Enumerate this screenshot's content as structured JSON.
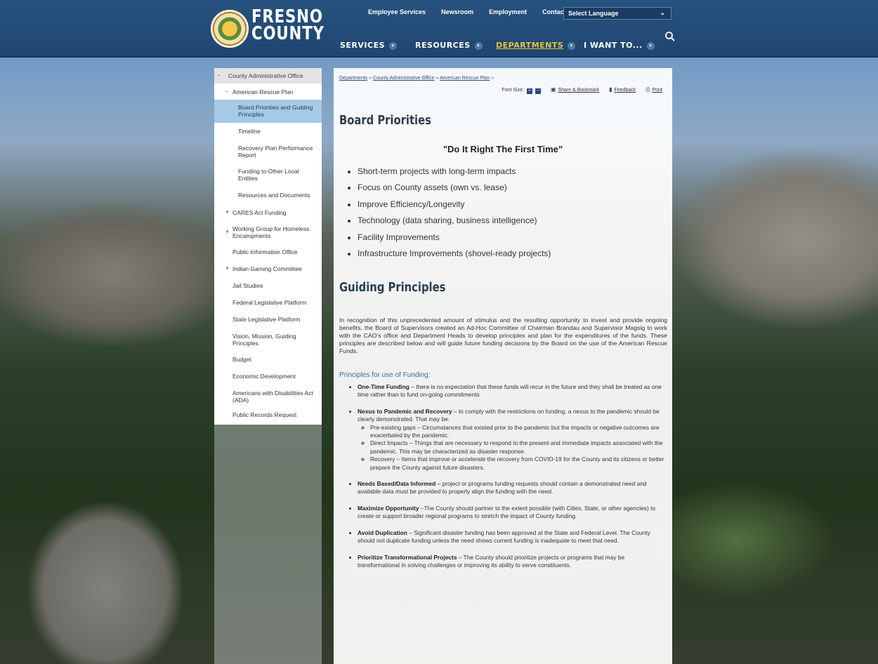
{
  "header": {
    "logo": {
      "seal_text": "THE COUNTY OF FRESNO",
      "line1": "FRESNO",
      "line2": "COUNTY"
    },
    "utility_nav": [
      "Employee Services",
      "Newsroom",
      "Employment",
      "Contact Us"
    ],
    "language_select": "Select Language",
    "main_nav": [
      {
        "label": "SERVICES"
      },
      {
        "label": "RESOURCES"
      },
      {
        "label": "DEPARTMENTS",
        "active": true
      },
      {
        "label": "I WANT TO..."
      }
    ],
    "search_icon": "search-icon"
  },
  "sidebar": {
    "items": [
      {
        "label": "County Administrative Office",
        "sign": "-"
      },
      {
        "label": "American Rescue Plan",
        "sign": "-"
      },
      {
        "label": "Board Priorities and Guiding Principles",
        "active": true
      },
      {
        "label": "Timeline"
      },
      {
        "label": "Recovery Plan Performance Report"
      },
      {
        "label": "Funding to Other Local Entities"
      },
      {
        "label": "Resources and Documents"
      },
      {
        "label": "CARES Act Funding",
        "sign": "+"
      },
      {
        "label": "Working Group for Homeless Encampments",
        "sign": "+"
      },
      {
        "label": "Public Information Office"
      },
      {
        "label": "Indian Gaming Committee",
        "sign": "+"
      },
      {
        "label": "Jail Studies"
      },
      {
        "label": "Federal Legislative Platform"
      },
      {
        "label": "State Legislative Platform"
      },
      {
        "label": "Vision, Mission, Guiding Principles"
      },
      {
        "label": "Budget"
      },
      {
        "label": "Economic Development"
      },
      {
        "label": "Americans with Disabilities Act (ADA)"
      },
      {
        "label": "Public Records Request"
      }
    ]
  },
  "breadcrumb": {
    "items": [
      "Departments",
      "County Administrative Office",
      "American Rescue Plan"
    ],
    "separator": "»"
  },
  "tools": {
    "font_size_label": "Font Size:",
    "plus": "+",
    "minus": "−",
    "share": "Share & Bookmark",
    "feedback": "Feedback",
    "print": "Print"
  },
  "content": {
    "heading1": "Board Priorities",
    "motto": "\"Do It Right The First Time\"",
    "priorities": [
      "Short-term projects with long-term impacts",
      "Focus on County assets (own vs. lease)",
      "Improve Efficiency/Longevity",
      "Technology (data sharing, business intelligence)",
      "Facility Improvements",
      "Infrastructure Improvements (shovel-ready projects)"
    ],
    "heading2": "Guiding Principles",
    "intro": "In recognition of this unprecedented amount of stimulus and the resulting opportunity to invest and provide ongoing benefits, the Board of Supervisors created an Ad-Hoc Committee of Chairman Brandau and Supervisor Magsig to work with the CAO's office and Department Heads to develop principles and plan for the expenditures of the funds. These principles are described below and will guide future funding decisions by the Board on the use of the American Rescue Funds.",
    "subheading": "Principles for use of Funding:",
    "principles": [
      {
        "title": "One-Time Funding",
        "text": " – there is no expectation that these funds will recur in the future and they shall be treated as one time rather than to fund on-going commitments"
      },
      {
        "title": "Nexus to Pandemic and Recovery",
        "text": " – to comply with the restrictions on funding, a nexus to the pandemic should be clearly demonstrated. That may be:",
        "sub": [
          "Pre-existing gaps – Circumstances that existed prior to the pandemic but the impacts or negative outcomes are exacerbated by the pandemic.",
          "Direct Impacts – Things that are necessary to respond to the present and immediate impacts associated with the pandemic. This may be characterized as disaster response.",
          "Recovery – Items that improve or accelerate the recovery from COVID-19 for the County and its citizens or better prepare the County against future disasters."
        ]
      },
      {
        "title": "Needs Based/Data Informed",
        "text": " – project or programs funding requests should contain a demonstrated need and available data must be provided to properly align the funding with the need."
      },
      {
        "title": "Maximize Opportunity",
        "text": " –The County should partner to the extent possible (with Cities, State, or other agencies) to create or support broader regional programs to stretch the impact of County funding."
      },
      {
        "title": "Avoid Duplication",
        "text": " – Significant disaster funding has been approved at the State and Federal Level. The County should not duplicate funding unless the need shows current funding is inadequate to meet that need."
      },
      {
        "title": "Prioritize Transformational Projects",
        "text": " – The County should prioritize projects or programs that may be transformational in solving challenges or improving its ability to serve constituents."
      }
    ]
  }
}
